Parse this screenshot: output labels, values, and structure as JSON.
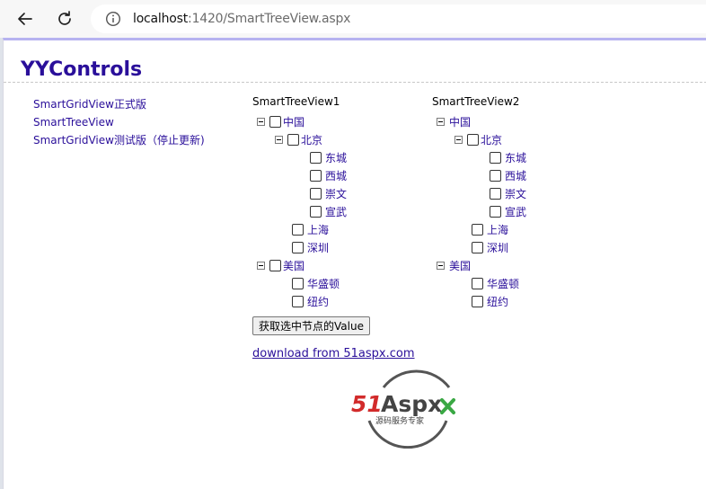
{
  "browser": {
    "url_host": "localhost",
    "url_path": ":1420/SmartTreeView.aspx"
  },
  "page": {
    "title": "YYControls",
    "side_nav": [
      {
        "label": "SmartGridView正式版"
      },
      {
        "label": "SmartTreeView"
      },
      {
        "label": "SmartGridView测试版（停止更新)"
      }
    ],
    "tree1": {
      "title": "SmartTreeView1",
      "nodes": [
        "中国",
        "北京",
        "东城",
        "西城",
        "崇文",
        "宣武",
        "上海",
        "深圳",
        "美国",
        "华盛顿",
        "纽约"
      ]
    },
    "tree2": {
      "title": "SmartTreeView2",
      "nodes": [
        "中国",
        "北京",
        "东城",
        "西城",
        "崇文",
        "宣武",
        "上海",
        "深圳",
        "美国",
        "华盛顿",
        "纽约"
      ]
    },
    "action_button": "获取选中节点的Value",
    "download_link": "download from 51aspx.com",
    "logo": {
      "brand": "51Aspx",
      "slogan": "源码服务专家"
    }
  },
  "colors": {
    "link": "#2a0f9a",
    "logo_red": "#d22b2b",
    "logo_green": "#3aa844"
  }
}
